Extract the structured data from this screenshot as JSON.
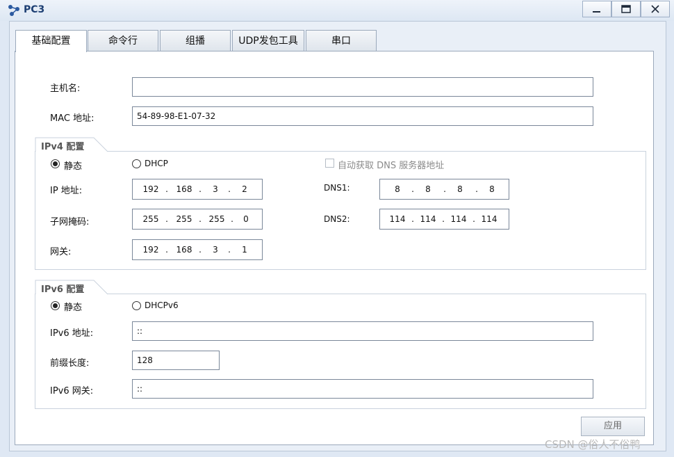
{
  "window": {
    "title": "PC3",
    "minimize_label": "_",
    "maximize_label": "",
    "close_label": "X"
  },
  "tabs": [
    {
      "label": "基础配置",
      "active": true
    },
    {
      "label": "命令行",
      "active": false
    },
    {
      "label": "组播",
      "active": false
    },
    {
      "label": "UDP发包工具",
      "active": false
    },
    {
      "label": "串口",
      "active": false
    }
  ],
  "basic": {
    "hostname_label": "主机名:",
    "hostname_value": "",
    "mac_label": "MAC 地址:",
    "mac_value": "54-89-98-E1-07-32"
  },
  "ipv4": {
    "group_title": "IPv4 配置",
    "static_label": "静态",
    "static_selected": true,
    "dhcp_label": "DHCP",
    "dhcp_selected": false,
    "auto_dns_label": "自动获取 DNS 服务器地址",
    "auto_dns_checked": false,
    "ip_label": "IP 地址:",
    "ip": [
      "192",
      "168",
      "3",
      "2"
    ],
    "mask_label": "子网掩码:",
    "mask": [
      "255",
      "255",
      "255",
      "0"
    ],
    "gateway_label": "网关:",
    "gateway": [
      "192",
      "168",
      "3",
      "1"
    ],
    "dns1_label": "DNS1:",
    "dns1": [
      "8",
      "8",
      "8",
      "8"
    ],
    "dns2_label": "DNS2:",
    "dns2": [
      "114",
      "114",
      "114",
      "114"
    ]
  },
  "ipv6": {
    "group_title": "IPv6 配置",
    "static_label": "静态",
    "static_selected": true,
    "dhcp_label": "DHCPv6",
    "dhcp_selected": false,
    "address_label": "IPv6 地址:",
    "address_value": "::",
    "prefix_label": "前缀长度:",
    "prefix_value": "128",
    "gateway_label": "IPv6 网关:",
    "gateway_value": "::"
  },
  "apply_label": "应用",
  "watermark": "CSDN @俗人不俗鸭"
}
